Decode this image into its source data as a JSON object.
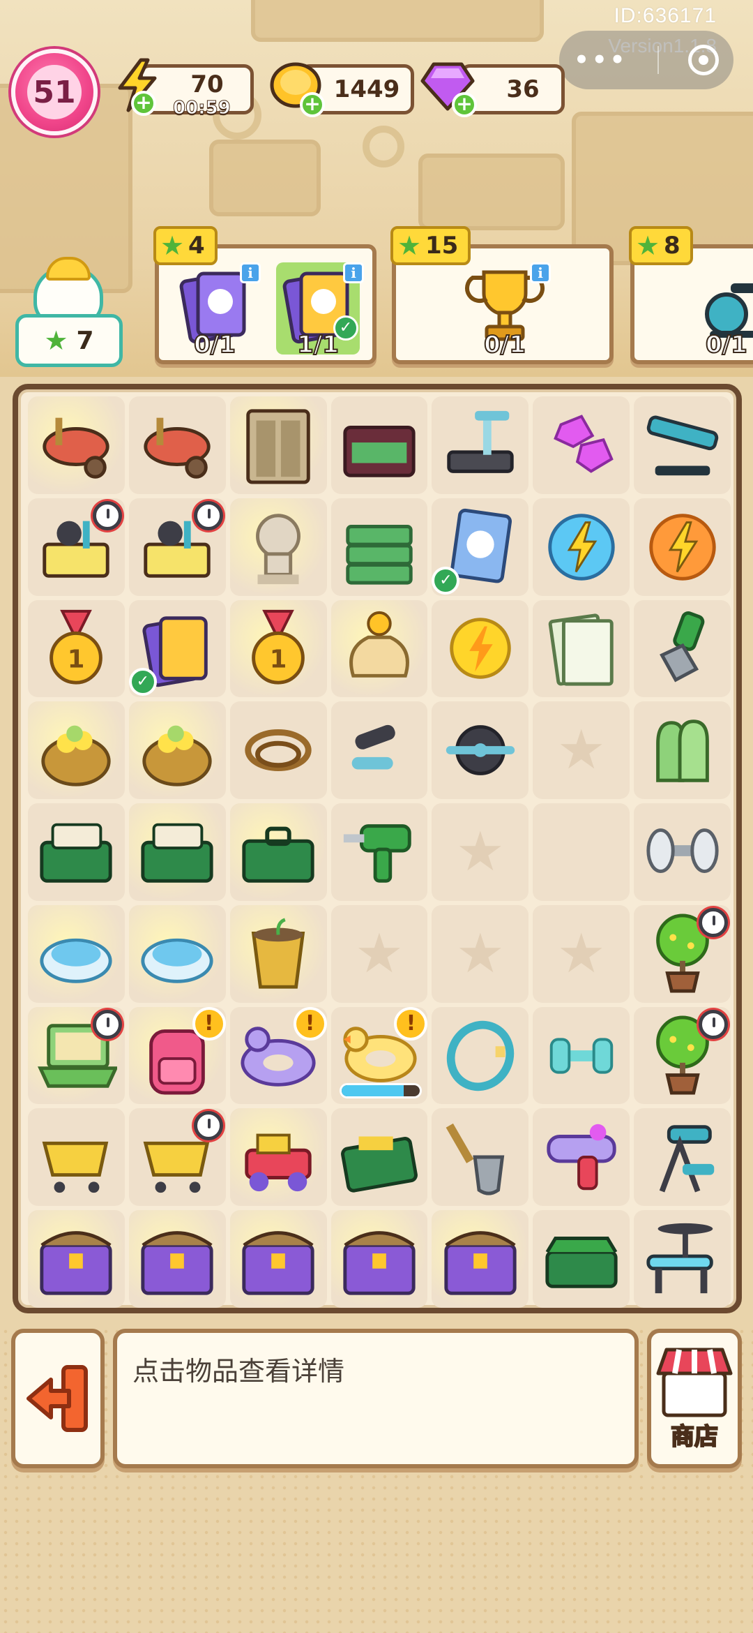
{
  "system": {
    "id_label": "ID:636171",
    "version_label": "Version1.1.8"
  },
  "player": {
    "level": "51"
  },
  "resources": {
    "energy": {
      "value": "70",
      "timer": "00:59",
      "icon": "lightning-icon"
    },
    "coins": {
      "value": "1449",
      "icon": "coin-icon"
    },
    "gems": {
      "value": "36",
      "icon": "gem-icon"
    }
  },
  "worker": {
    "stars": "7"
  },
  "orders": [
    {
      "reward": "4",
      "items": [
        {
          "name": "card-pack-purple",
          "progress": "0/1",
          "done": false
        },
        {
          "name": "card-pack-yellow",
          "progress": "1/1",
          "done": true
        }
      ]
    },
    {
      "reward": "15",
      "items": [
        {
          "name": "gold-trophy",
          "progress": "0/1",
          "done": false
        }
      ]
    },
    {
      "reward": "8",
      "items": [
        {
          "name": "exercise-bike",
          "progress": "0/1",
          "done": false
        }
      ]
    }
  ],
  "board": {
    "columns": 7,
    "rows": 9,
    "cells": [
      "wheelbarrow",
      "wheelbarrow",
      "locker-cabinet",
      "cash-briefcase",
      "treadmill",
      "pink-gems",
      "ab-bench",
      "equipment-cart",
      "equipment-cart",
      "statue",
      "cash-stack",
      "sticker-card",
      "energy-orb-blue",
      "energy-orb-orange",
      "gold-medal",
      "card-pack",
      "gold-medal",
      "coin-sack",
      "energy-coin",
      "newspaper",
      "pliers",
      "flower-basket",
      "flower-basket",
      "jump-rope",
      "hand-grip",
      "ab-roller",
      "empty",
      "gloves",
      "toolbox-open",
      "toolbox-open",
      "toolbox-closed",
      "power-drill",
      "empty",
      "blank",
      "dumbbell",
      "robot-vacuum",
      "robot-vacuum",
      "flower-pot",
      "empty",
      "empty",
      "empty",
      "potted-tree",
      "laptop",
      "backpack",
      "unicorn-float",
      "duck-float",
      "hula-hoop",
      "small-dumbbell",
      "potted-tree",
      "shopping-cart",
      "shopping-cart",
      "toy-truck",
      "green-toolbox",
      "shovel",
      "water-gun",
      "bench-press",
      "treasure-chest",
      "treasure-chest",
      "treasure-chest",
      "treasure-chest",
      "treasure-chest",
      "tackle-box",
      "weight-bench"
    ],
    "duck_float_progress": 0.8
  },
  "panel": {
    "hint": "点击物品查看详情",
    "shop_label": "商店"
  },
  "colors": {
    "accent_green": "#5fc43a",
    "level_pink": "#f0458a",
    "frame_brown": "#6b4a30"
  }
}
